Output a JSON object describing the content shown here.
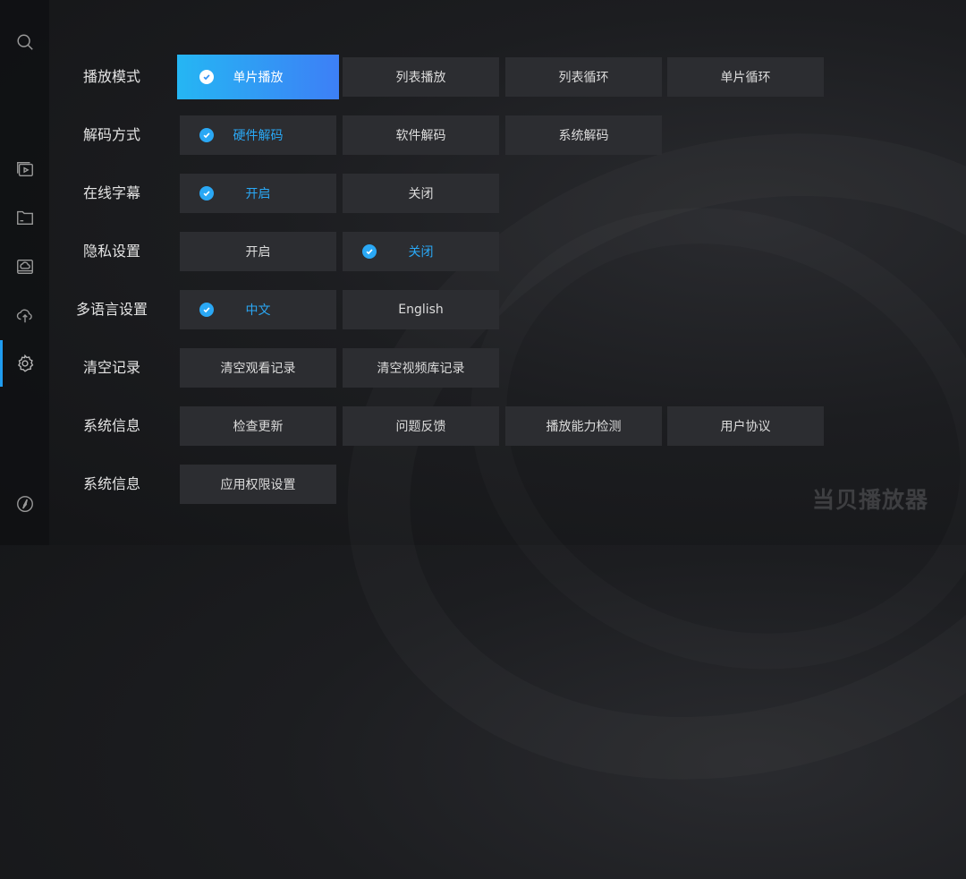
{
  "sidebar": {
    "icons": [
      "search-icon",
      "video-library-icon",
      "folder-icon",
      "cloud-drive-icon",
      "cloud-upload-icon",
      "gear-icon",
      "compass-icon"
    ],
    "active": "gear-icon",
    "accent": "#1f9cf0"
  },
  "rows": [
    {
      "label": "播放模式",
      "options": [
        "单片播放",
        "列表播放",
        "列表循环",
        "单片循环"
      ],
      "selected": 0,
      "focused": 0
    },
    {
      "label": "解码方式",
      "options": [
        "硬件解码",
        "软件解码",
        "系统解码"
      ],
      "selected": 0
    },
    {
      "label": "在线字幕",
      "options": [
        "开启",
        "关闭"
      ],
      "selected": 0
    },
    {
      "label": "隐私设置",
      "options": [
        "开启",
        "关闭"
      ],
      "selected": 1
    },
    {
      "label": "多语言设置",
      "options": [
        "中文",
        "English"
      ],
      "selected": 0
    },
    {
      "label": "清空记录",
      "options": [
        "清空观看记录",
        "清空视频库记录"
      ]
    },
    {
      "label": "系统信息",
      "options": [
        "检查更新",
        "问题反馈",
        "播放能力检测",
        "用户协议"
      ]
    },
    {
      "label": "系统信息",
      "options": [
        "应用权限设置"
      ]
    }
  ],
  "watermark": "当贝播放器",
  "colors": {
    "focus_start": "#25b6f3",
    "focus_end": "#3d7ff6",
    "selected_text": "#2aa8f5",
    "option_bg": "#2c2d31"
  }
}
